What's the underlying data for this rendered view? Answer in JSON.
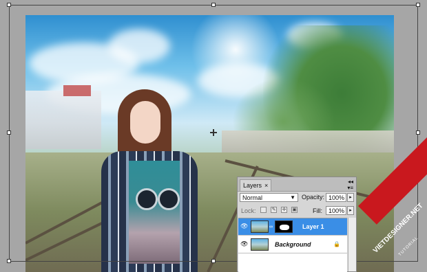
{
  "layers_panel": {
    "tab_label": "Layers",
    "tab_close": "×",
    "blend_mode": "Normal",
    "opacity_label": "Opacity:",
    "opacity_value": "100%",
    "lock_label": "Lock:",
    "fill_label": "Fill:",
    "fill_value": "100%",
    "layers": [
      {
        "name": "Layer 1",
        "selected": true,
        "visible": true
      },
      {
        "name": "Background",
        "selected": false,
        "visible": true,
        "locked": true
      }
    ]
  },
  "watermark": {
    "site": "VIETDESIGNER.NET",
    "sub": "TUTORIAL"
  },
  "colors": {
    "canvas_bg": "#a6a6a6",
    "selection": "#3a8ee6",
    "badge": "#c9181e"
  },
  "icons": [
    "eye-icon",
    "lock-icon",
    "link-icon",
    "move-icon",
    "brush-icon",
    "pixel-lock-icon",
    "crosshair-icon"
  ]
}
